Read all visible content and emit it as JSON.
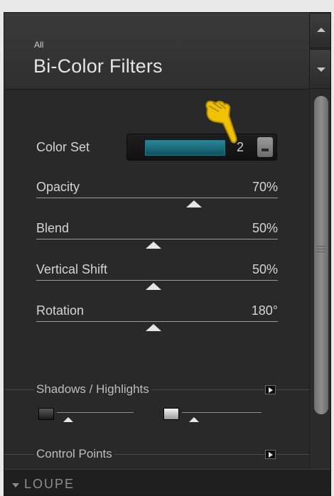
{
  "header": {
    "breadcrumb": "All",
    "title": "Bi-Color Filters"
  },
  "color_set": {
    "label": "Color Set",
    "value": "2",
    "swatch_color": "#1f7886"
  },
  "sliders": [
    {
      "label": "Opacity",
      "value_text": "70%",
      "level": 0.7
    },
    {
      "label": "Blend",
      "value_text": "50%",
      "level": 0.5
    },
    {
      "label": "Vertical Shift",
      "value_text": "50%",
      "level": 0.5
    },
    {
      "label": "Rotation",
      "value_text": "180°",
      "level": 0.5
    }
  ],
  "sections": {
    "shadows_highlights": "Shadows / Highlights",
    "control_points": "Control Points"
  },
  "mini_sliders": [
    {
      "name": "shadows",
      "level": 0.05
    },
    {
      "name": "highlights",
      "level": 0.05
    }
  ],
  "footer": {
    "loupe_label": "LOUPE"
  },
  "icons": {
    "cursor": "hand-pointer-icon",
    "scroll_up": "up-arrow-icon",
    "scroll_down": "down-arrow-icon"
  },
  "colors": {
    "panel_bg": "#292929",
    "cursor_yellow": "#f0c400"
  }
}
